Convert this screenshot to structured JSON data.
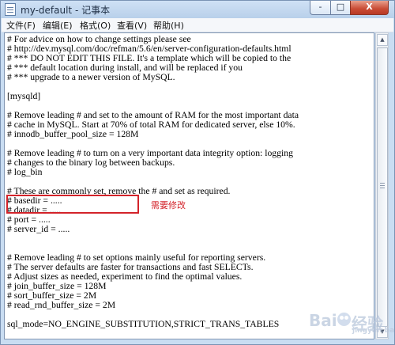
{
  "window": {
    "title": "my-default - 记事本",
    "controls": [
      "-",
      "□",
      "X"
    ]
  },
  "menu": [
    "文件(F)",
    "编辑(E)",
    "格式(O)",
    "查看(V)",
    "帮助(H)"
  ],
  "document": {
    "lines": [
      "# For advice on how to change settings please see",
      "# http://dev.mysql.com/doc/refman/5.6/en/server-configuration-defaults.html",
      "# *** DO NOT EDIT THIS FILE. It's a template which will be copied to the",
      "# *** default location during install, and will be replaced if you",
      "# *** upgrade to a newer version of MySQL.",
      "",
      "[mysqld]",
      "",
      "# Remove leading # and set to the amount of RAM for the most important data",
      "# cache in MySQL. Start at 70% of total RAM for dedicated server, else 10%.",
      "# innodb_buffer_pool_size = 128M",
      "",
      "# Remove leading # to turn on a very important data integrity option: logging",
      "# changes to the binary log between backups.",
      "# log_bin",
      "",
      "# These are commonly set, remove the # and set as required.",
      "# basedir = .....",
      "# datadir = .....",
      "# port = .....",
      "# server_id = .....",
      "",
      "",
      "# Remove leading # to set options mainly useful for reporting servers.",
      "# The server defaults are faster for transactions and fast SELECTs.",
      "# Adjust sizes as needed, experiment to find the optimal values.",
      "# join_buffer_size = 128M",
      "# sort_buffer_size = 2M",
      "# read_rnd_buffer_size = 2M",
      "",
      "sql_mode=NO_ENGINE_SUBSTITUTION,STRICT_TRANS_TABLES"
    ]
  },
  "annotation": {
    "text": "需要修改",
    "color": "#d3232a"
  },
  "watermark": {
    "left": "Bai",
    "right": "经验",
    "small": "jingyan.baidu.com"
  }
}
